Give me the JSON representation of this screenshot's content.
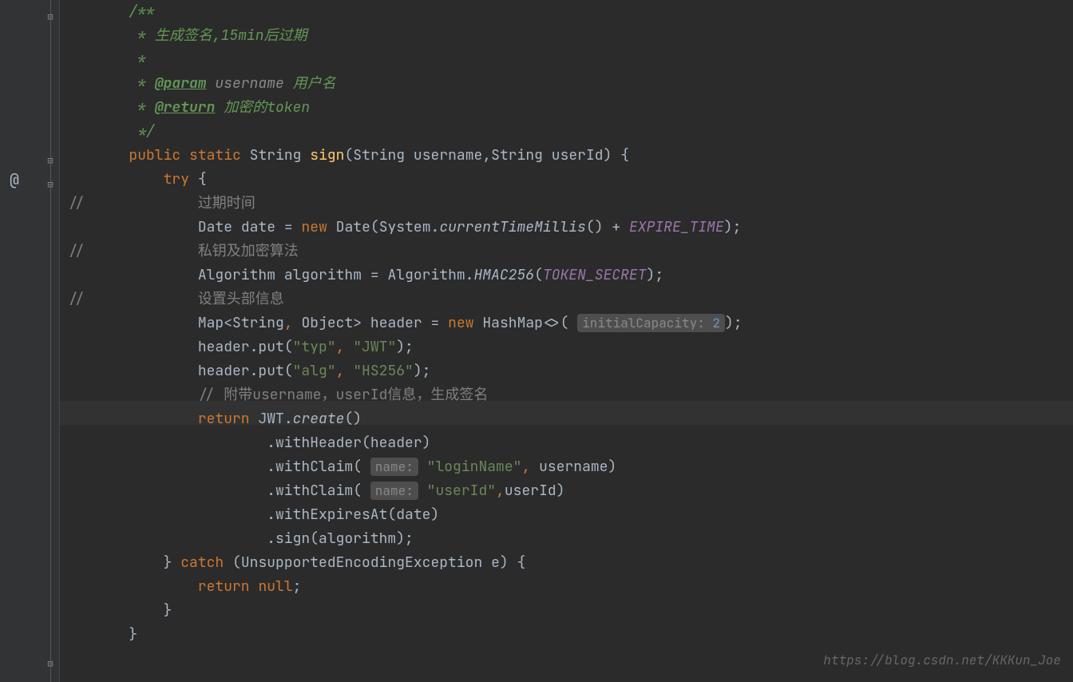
{
  "watermark": "https://blog.csdn.net/KKKun_Joe",
  "code": {
    "doc1": "/**",
    "doc2": " * 生成签名,",
    "doc2b": "15min",
    "doc2c": "后过期",
    "doc3": " *",
    "doc4": " * ",
    "doc4tag": "@param",
    "doc4param": " username",
    "doc4desc": " 用户名",
    "doc5": " * ",
    "doc5tag": "@return",
    "doc5desc": " 加密的",
    "doc5desc2": "token",
    "doc6": " */",
    "kw_public": "public",
    "kw_static": "static",
    "kw_try": "try",
    "kw_new": "new",
    "kw_return": "return",
    "kw_null": "null",
    "kw_catch": "catch",
    "type_string": "String",
    "method_sign": "sign",
    "param_username": "username",
    "param_userid": "userId",
    "open_brace": " {",
    "comment_marker": "//",
    "c1": "过期时间",
    "c2": "私钥及加密算法",
    "c3": "设置头部信息",
    "c4": "// 附带username，userId信息，生成签名",
    "type_date": "Date",
    "var_date": "date",
    "sys": "System.",
    "ctm": "currentTimeMillis",
    "expire": "EXPIRE_TIME",
    "type_algo": "Algorithm",
    "var_algo": "algorithm",
    "hmac": "HMAC256",
    "secret": "TOKEN_SECRET",
    "type_map": "Map",
    "type_object": "Object",
    "var_header": "header",
    "type_hashmap": "HashMap",
    "hint_cap": "initialCapacity:",
    "hint_cap_val": "2",
    "put": "header.put",
    "str_typ": "\"typ\"",
    "str_jwt": "\"JWT\"",
    "str_alg": "\"alg\"",
    "str_hs256": "\"HS256\"",
    "jwt": "JWT.",
    "create": "create",
    "withHeader": ".withHeader",
    "withClaim": ".withClaim",
    "hint_name": "name:",
    "str_login": "\"loginName\"",
    "str_userid": "\"userId\"",
    "withExpires": ".withExpiresAt",
    "sign_m": ".sign",
    "exc": "UnsupportedEncodingException",
    "exc_var": "e"
  }
}
